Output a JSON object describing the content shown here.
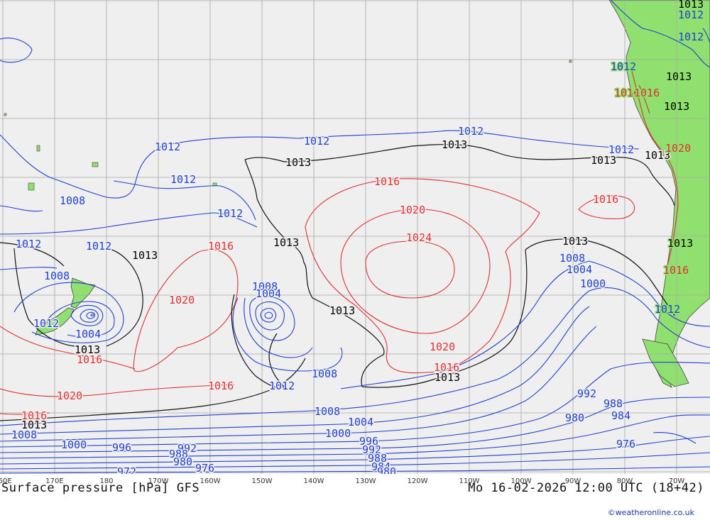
{
  "footer": {
    "title": "Surface pressure [hPa] GFS",
    "valid_time": "Mo 16-02-2026 12:00 UTC (18+42)",
    "copyright": "©weatheronline.co.uk"
  },
  "lon_labels": [
    "160E",
    "170E",
    "180",
    "170W",
    "160W",
    "150W",
    "140W",
    "130W",
    "120W",
    "110W",
    "100W",
    "90W",
    "80W",
    "70W"
  ],
  "colors": {
    "ocean": "#efefef",
    "land": "#90e070",
    "grid": "#a8a8a8",
    "low_isobar": "#2040d0",
    "high_isobar": "#e03030",
    "standard_isobar": "#000000"
  },
  "isobar_labels": [
    {
      "text": "1013",
      "color": "black"
    },
    {
      "text": "1013",
      "color": "black"
    },
    {
      "text": "1013",
      "color": "black"
    },
    {
      "text": "1013",
      "color": "black"
    },
    {
      "text": "1013",
      "color": "black"
    },
    {
      "text": "1013",
      "color": "black"
    },
    {
      "text": "1013",
      "color": "black"
    },
    {
      "text": "1013",
      "color": "black"
    },
    {
      "text": "1013",
      "color": "black"
    },
    {
      "text": "1013",
      "color": "black"
    },
    {
      "text": "1013",
      "color": "black"
    },
    {
      "text": "1013",
      "color": "black"
    },
    {
      "text": "1013",
      "color": "black"
    },
    {
      "text": "1013",
      "color": "black"
    },
    {
      "text": "1013",
      "color": "black"
    },
    {
      "text": "1012",
      "color": "blue"
    },
    {
      "text": "1012",
      "color": "blue"
    },
    {
      "text": "1012",
      "color": "blue"
    },
    {
      "text": "1012",
      "color": "blue"
    },
    {
      "text": "1012",
      "color": "blue"
    },
    {
      "text": "1012",
      "color": "blue"
    },
    {
      "text": "1012",
      "color": "blue"
    },
    {
      "text": "1012",
      "color": "blue"
    },
    {
      "text": "1012",
      "color": "blue"
    },
    {
      "text": "1012",
      "color": "blue"
    },
    {
      "text": "1012",
      "color": "blue"
    },
    {
      "text": "1012",
      "color": "blue"
    },
    {
      "text": "1012",
      "color": "blue"
    },
    {
      "text": "1012",
      "color": "blue"
    },
    {
      "text": "1008",
      "color": "blue"
    },
    {
      "text": "1008",
      "color": "blue"
    },
    {
      "text": "1008",
      "color": "blue"
    },
    {
      "text": "1008",
      "color": "blue"
    },
    {
      "text": "1008",
      "color": "blue"
    },
    {
      "text": "1008",
      "color": "blue"
    },
    {
      "text": "1008",
      "color": "blue"
    },
    {
      "text": "1004",
      "color": "blue"
    },
    {
      "text": "1004",
      "color": "blue"
    },
    {
      "text": "1004",
      "color": "blue"
    },
    {
      "text": "1004",
      "color": "blue"
    },
    {
      "text": "1000",
      "color": "blue"
    },
    {
      "text": "1000",
      "color": "blue"
    },
    {
      "text": "1000",
      "color": "blue"
    },
    {
      "text": "996",
      "color": "blue"
    },
    {
      "text": "996",
      "color": "blue"
    },
    {
      "text": "992",
      "color": "blue"
    },
    {
      "text": "992",
      "color": "blue"
    },
    {
      "text": "992",
      "color": "blue"
    },
    {
      "text": "988",
      "color": "blue"
    },
    {
      "text": "988",
      "color": "blue"
    },
    {
      "text": "988",
      "color": "blue"
    },
    {
      "text": "984",
      "color": "blue"
    },
    {
      "text": "984",
      "color": "blue"
    },
    {
      "text": "980",
      "color": "blue"
    },
    {
      "text": "980",
      "color": "blue"
    },
    {
      "text": "980",
      "color": "blue"
    },
    {
      "text": "976",
      "color": "blue"
    },
    {
      "text": "976",
      "color": "blue"
    },
    {
      "text": "972",
      "color": "blue"
    },
    {
      "text": "1016",
      "color": "red"
    },
    {
      "text": "1016",
      "color": "red"
    },
    {
      "text": "1016",
      "color": "red"
    },
    {
      "text": "1016",
      "color": "red"
    },
    {
      "text": "1016",
      "color": "red"
    },
    {
      "text": "1016",
      "color": "red"
    },
    {
      "text": "1016",
      "color": "red"
    },
    {
      "text": "1016",
      "color": "red"
    },
    {
      "text": "1016",
      "color": "red"
    },
    {
      "text": "1016",
      "color": "red"
    },
    {
      "text": "1020",
      "color": "red"
    },
    {
      "text": "1020",
      "color": "red"
    },
    {
      "text": "1020",
      "color": "red"
    },
    {
      "text": "1020",
      "color": "red"
    },
    {
      "text": "1020",
      "color": "red"
    },
    {
      "text": "1024",
      "color": "red"
    }
  ]
}
